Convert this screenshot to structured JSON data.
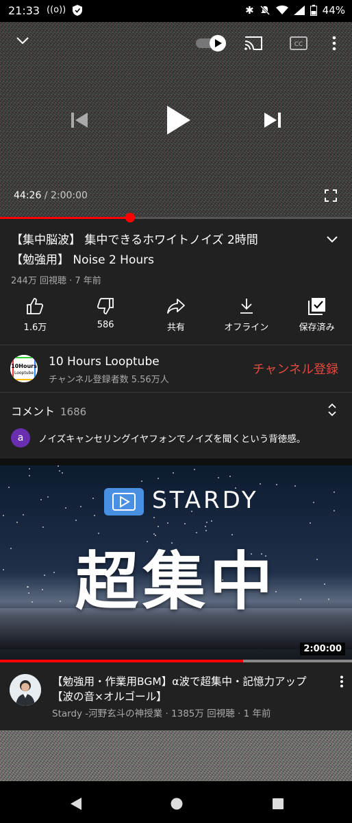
{
  "status_bar": {
    "time": "21:33",
    "battery": "44%"
  },
  "player": {
    "current_time": "44:26",
    "separator": " / ",
    "duration": "2:00:00",
    "progress": 0.37
  },
  "video": {
    "title_line1": "【集中脳波】 集中できるホワイトノイズ 2時間",
    "title_line2": "【勉強用】 Noise 2 Hours",
    "meta": "244万 回視聴 · 7 年前"
  },
  "actions": {
    "like": "1.6万",
    "dislike": "586",
    "share": "共有",
    "offline": "オフライン",
    "saved": "保存済み"
  },
  "channel": {
    "name": "10 Hours Looptube",
    "subscribers": "チャンネル登録者数 5.56万人",
    "subscribe_label": "チャンネル登録",
    "avatar_text_1": "10Hours",
    "avatar_text_2": "Looptube"
  },
  "comments": {
    "label": "コメント",
    "count": "1686",
    "avatar_letter": "a",
    "top_comment": "ノイズキャンセリングイヤフォンでノイズを聞くという背徳感。"
  },
  "next_video": {
    "thumb_brand": "STARDY",
    "thumb_headline": "超集中",
    "duration": "2:00:00",
    "watched_fraction": 0.69,
    "title": "【勉強用・作業用BGM】α波で超集中・記憶力アップ【波の音×オルゴール】",
    "meta": "Stardy -河野玄斗の神授業 · 1385万 回視聴 · 1 年前"
  },
  "colors": {
    "accent_red": "#ff0000",
    "subscribe_red": "#e24a3f",
    "background": "#212121",
    "secondary_text": "#aaaaaa"
  }
}
